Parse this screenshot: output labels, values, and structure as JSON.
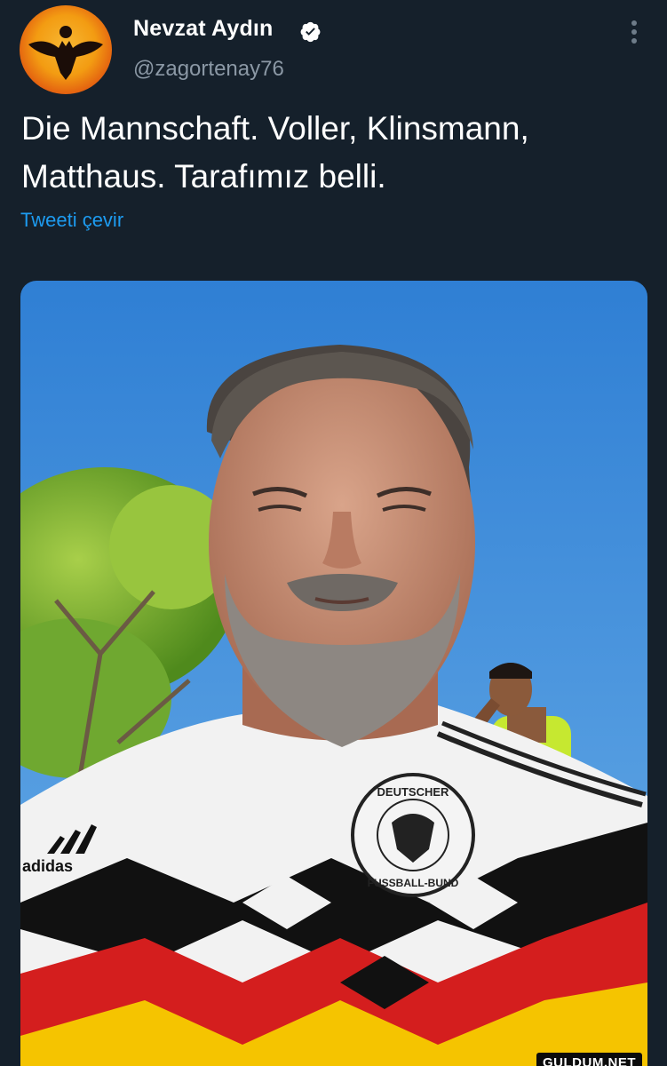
{
  "tweet": {
    "author": {
      "display_name": "Nevzat Aydın",
      "handle": "@zagortenay76",
      "verified": true,
      "avatar_icon": "zagor-bat-logo-icon"
    },
    "text_lines": [
      "Die Mannschaft. Voller, Klinsmann,",
      "Matthaus. Tarafımız belli."
    ],
    "translate_label": "Tweeti çevir",
    "media": {
      "type": "photo",
      "jersey_crest_text_top": "DEUTSCHER",
      "jersey_crest_text_bottom": "FUSSBALL-BUND",
      "jersey_brand": "adidas"
    }
  },
  "watermark": "GULDUM.NET",
  "colors": {
    "background": "#15202b",
    "text": "#ffffff",
    "secondary_text": "#8b98a5",
    "link": "#1d9bf0",
    "verified_badge": "#ffffff"
  }
}
